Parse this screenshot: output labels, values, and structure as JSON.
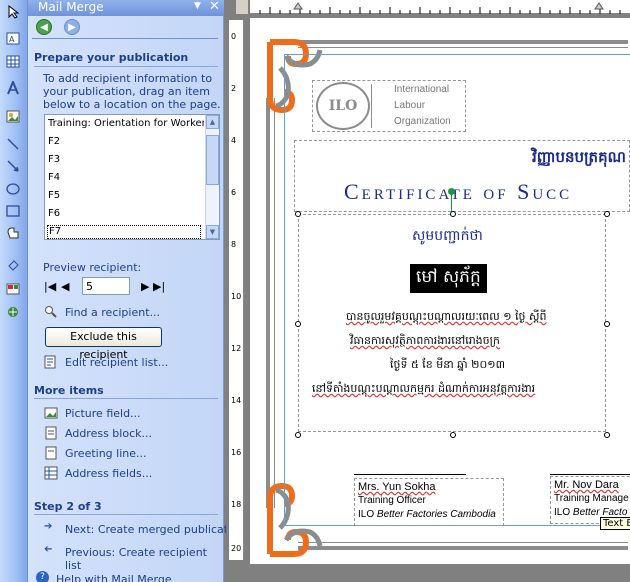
{
  "toolbar": {
    "icons": [
      "select-arrow-icon",
      "text-box-icon",
      "table-icon",
      "wordart-icon",
      "picture-icon",
      "line-icon",
      "arrow-line-icon",
      "oval-icon",
      "rectangle-icon",
      "autoshapes-icon",
      "fill-icon",
      "design-gallery-icon",
      "hot-spot-icon"
    ]
  },
  "pane": {
    "title": "Mail Merge",
    "section1": {
      "heading": "Prepare your publication",
      "instructions": [
        "To add recipient information to",
        "your publication, drag an item",
        "below to a location on the page."
      ]
    },
    "fields": [
      "Training: Orientation for Worker",
      "F2",
      "F3",
      "F4",
      "F5",
      "F6",
      "F7"
    ],
    "preview_label": "Preview recipient:",
    "preview_value": "5",
    "find_recipient": "Find a recipient...",
    "exclude_button": "Exclude this recipient",
    "edit_list": "Edit recipient list...",
    "more_items_heading": "More items",
    "more_items": [
      "Picture field...",
      "Address block...",
      "Greeting line...",
      "Address fields..."
    ],
    "step_label": "Step 2 of 3",
    "next_step": "Next: Create merged publications",
    "previous_step": "Previous: Create recipient list",
    "help": "Help with Mail Merge"
  },
  "ruler": {
    "v_labels": [
      "0",
      "2",
      "4",
      "6",
      "8",
      "10",
      "12",
      "14",
      "16",
      "18",
      "20"
    ]
  },
  "certificate": {
    "ilo_logo": "ILO",
    "org_lines": [
      "International",
      "Labour",
      "Organization"
    ],
    "khmer_title": "វិញ្ញាបនបត្រគុណ",
    "english_title": "Certificate of Succ",
    "khmer_subtitle": "សូមបញ្ជាក់ថា",
    "recipient_name": "មៅ សុភ័ក្ត",
    "body_lines": [
      "បានចូលរួមវគ្គបណ្តុះបណ្តាលរយៈពេល ១ ថ្ងៃ ស្តីពី",
      "វិធានការសុវត្ថិភាពការងារនៅរោងចក្រ",
      "ថ្ងៃទី ៥ ខែ មីនា ឆ្នាំ ២០១៣",
      "នៅទីតាំងបណ្តុះបណ្តាលកម្មករ ដំណាក់ការអនុវត្តការងារ"
    ],
    "signer1": {
      "name": "Mrs. Yun Sokha",
      "title": "Training Officer",
      "org_prefix": "ILO ",
      "org_italic": "Better Factories Cambodia"
    },
    "signer2": {
      "name": "Mr. Nov Dara",
      "title": "Training Manage",
      "org_prefix": "ILO ",
      "org_italic": "Better Facto"
    },
    "tooltip": "Text B"
  },
  "colors": {
    "accent_orange": "#ef6c1a",
    "navy": "#1d2b8a",
    "frame_gray": "#8c8c8c"
  }
}
